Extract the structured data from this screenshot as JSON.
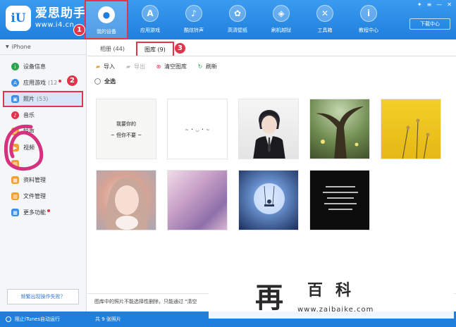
{
  "app": {
    "logo_glyph": "iU",
    "name": "爱思助手",
    "url": "www.i4.cn"
  },
  "nav": [
    {
      "label": "我的设备",
      "icon": "apple-icon",
      "glyph": "●"
    },
    {
      "label": "应用游戏",
      "icon": "appstore-icon",
      "glyph": "A"
    },
    {
      "label": "酷炫铃声",
      "icon": "bell-icon",
      "glyph": "♪"
    },
    {
      "label": "高清壁纸",
      "icon": "wallpaper-icon",
      "glyph": "✿"
    },
    {
      "label": "刷机越狱",
      "icon": "flash-box-icon",
      "glyph": "◈"
    },
    {
      "label": "工具箱",
      "icon": "tools-icon",
      "glyph": "✕"
    },
    {
      "label": "教程中心",
      "icon": "info-icon",
      "glyph": "i"
    }
  ],
  "window_controls": {
    "pin": "✦",
    "settings": "≡",
    "minimize": "—",
    "close": "✕"
  },
  "download_center": "下载中心",
  "callouts": {
    "one": "1",
    "two": "2",
    "three": "3"
  },
  "sidebar": {
    "device_name": "iPhone",
    "items": [
      {
        "label": "设备信息",
        "icon": "info-icon",
        "color": "#2ea44f",
        "glyph": "i",
        "count": ""
      },
      {
        "label": "应用游戏",
        "icon": "appstore-icon",
        "color": "#3a8ee6",
        "glyph": "A",
        "count": "(12"
      },
      {
        "label": "照片",
        "icon": "photo-icon",
        "color": "#3a8ee6",
        "glyph": "▣",
        "count": "(53)"
      },
      {
        "label": "音乐",
        "icon": "music-icon",
        "color": "#e3344c",
        "glyph": "♪",
        "count": ""
      },
      {
        "label": "铃声",
        "icon": "ringtone-icon",
        "color": "#f0a030",
        "glyph": "♫",
        "count": ""
      },
      {
        "label": "视频",
        "icon": "video-icon",
        "color": "#f0a030",
        "glyph": "▶",
        "count": ""
      },
      {
        "label": "",
        "icon": "book-icon",
        "color": "#f0a030",
        "glyph": "▤",
        "count": ""
      },
      {
        "label": "资料管理",
        "icon": "contacts-icon",
        "color": "#f0a030",
        "glyph": "▦",
        "count": ""
      },
      {
        "label": "文件管理",
        "icon": "file-icon",
        "color": "#f0a030",
        "glyph": "▥",
        "count": ""
      },
      {
        "label": "更多功能",
        "icon": "more-icon",
        "color": "#3a8ee6",
        "glyph": "▦",
        "count": ""
      }
    ],
    "feedback": "频繁出现操作失败？"
  },
  "tabs": [
    {
      "label": "相册 (44)"
    },
    {
      "label": "图库 (9)"
    }
  ],
  "toolbar": {
    "import": "导入",
    "export": "导出",
    "clear": "清空图库",
    "refresh": "刷新"
  },
  "select_all": "全选",
  "thumbs": [
    {
      "caption_top": "我要你的",
      "caption_bottom": "~ 但你不要 ~"
    },
    {
      "caption_top": "",
      "caption_bottom": "~ ・ ◡ ・ ~"
    },
    {
      "caption_top": "",
      "caption_bottom": ""
    },
    {
      "caption_top": "",
      "caption_bottom": ""
    },
    {
      "caption_top": "",
      "caption_bottom": ""
    },
    {
      "caption_top": "",
      "caption_bottom": ""
    },
    {
      "caption_top": "",
      "caption_bottom": ""
    },
    {
      "caption_top": "",
      "caption_bottom": ""
    },
    {
      "caption_top": "",
      "caption_bottom": ""
    }
  ],
  "notice": "图库中的照片不能选择性删除，只能通过 \"清空",
  "status": {
    "itunes": "阻止iTunes自动运行",
    "count": "共 9 张照片"
  },
  "watermark": {
    "big": "再",
    "mid": "百科",
    "url": "www.zaibaike.com"
  },
  "colors": {
    "brand": "#1f7fdc",
    "callout": "#e3344c",
    "sidebar_active": "#d6e6f8"
  }
}
